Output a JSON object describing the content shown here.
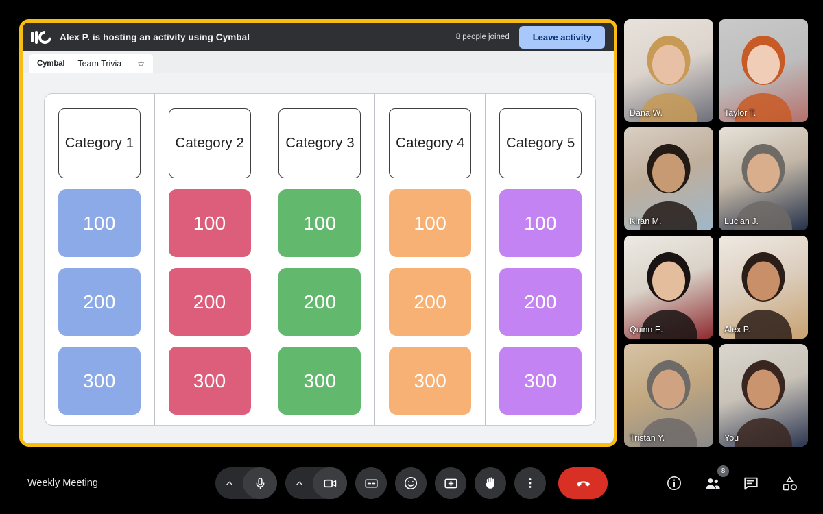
{
  "activity": {
    "logo_icon": "cymbal-logo-icon",
    "host_text": "Alex P. is hosting an activity using Cymbal",
    "joined_count": "8 people joined",
    "leave_label": "Leave activity",
    "brand": "Cymbal",
    "tab_title": "Team Trivia",
    "star_icon": "☆"
  },
  "board": {
    "columns": [
      {
        "category": "Category 1",
        "color": "#8CA9E8",
        "tiles": [
          "100",
          "200",
          "300"
        ]
      },
      {
        "category": "Category 2",
        "color": "#DC5E7B",
        "tiles": [
          "100",
          "200",
          "300"
        ]
      },
      {
        "category": "Category 3",
        "color": "#62B96E",
        "tiles": [
          "100",
          "200",
          "300"
        ]
      },
      {
        "category": "Category 4",
        "color": "#F8B174",
        "tiles": [
          "100",
          "200",
          "300"
        ]
      },
      {
        "category": "Category 5",
        "color": "#C483F3",
        "tiles": [
          "100",
          "200",
          "300"
        ]
      }
    ]
  },
  "participants": [
    {
      "name": "Dana W.",
      "self": false
    },
    {
      "name": "Taylor T.",
      "self": false
    },
    {
      "name": "Kiran M.",
      "self": false
    },
    {
      "name": "Lucian J.",
      "self": false
    },
    {
      "name": "Quinn E.",
      "self": false
    },
    {
      "name": "Alex P.",
      "self": false
    },
    {
      "name": "Tristan Y.",
      "self": false
    },
    {
      "name": "You",
      "self": true
    }
  ],
  "bottombar": {
    "meeting_name": "Weekly Meeting",
    "controls": [
      {
        "name": "microphone",
        "icon": "mic-icon",
        "has_chevron": true
      },
      {
        "name": "camera",
        "icon": "video-camera-icon",
        "has_chevron": true
      },
      {
        "name": "captions",
        "icon": "closed-captions-icon"
      },
      {
        "name": "reactions",
        "icon": "emoji-smiley-icon"
      },
      {
        "name": "present",
        "icon": "present-screen-icon"
      },
      {
        "name": "raise-hand",
        "icon": "raised-hand-icon"
      },
      {
        "name": "more-options",
        "icon": "more-vertical-icon"
      },
      {
        "name": "end-call",
        "icon": "phone-hangup-icon"
      }
    ],
    "right_controls": [
      {
        "name": "meeting-details",
        "icon": "info-circle-icon"
      },
      {
        "name": "people",
        "icon": "people-icon",
        "badge": "8"
      },
      {
        "name": "chat",
        "icon": "chat-bubble-icon"
      },
      {
        "name": "activities",
        "icon": "activities-shapes-icon"
      }
    ]
  },
  "colors": {
    "accent_yellow": "#F9BC15",
    "leave_button": "#A8C7FA",
    "self_border": "#8AB4F8",
    "end_call": "#D93025"
  }
}
